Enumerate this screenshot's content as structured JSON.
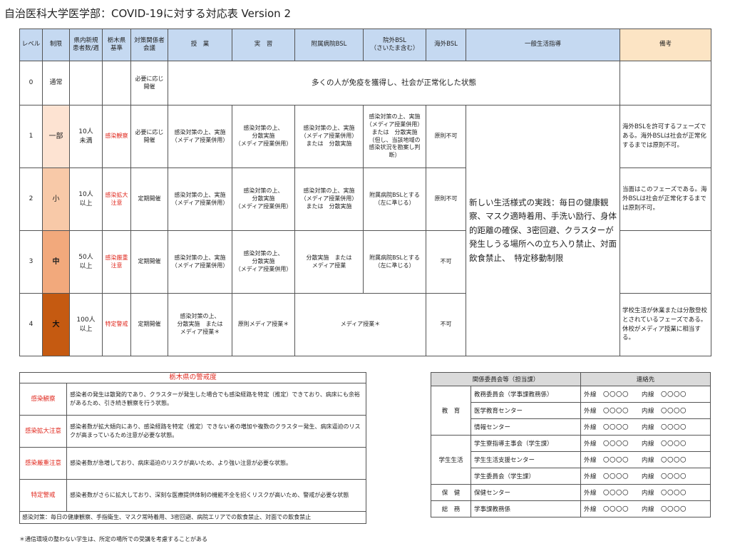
{
  "title": "自治医科大学医学部：COVID-19に対する対応表 Version 2",
  "main": {
    "headers": [
      "レベル",
      "制限",
      "県内新規\n患者数/週",
      "栃木県\n基準",
      "対策関係者\n会議",
      "授　業",
      "実　習",
      "附属病院BSL",
      "院外BSL\n（さいたま含む）",
      "海外BSL",
      "一般生活指導",
      "備考"
    ],
    "levels": [
      "0",
      "1",
      "2",
      "3",
      "4"
    ],
    "restrictions": [
      "通常",
      "一部",
      "小",
      "中",
      "大"
    ],
    "cases": [
      "",
      "10人\n未満",
      "10人\n以上",
      "50人\n以上",
      "100人\n以上"
    ],
    "tochigi": [
      "",
      "感染観察",
      "感染拡大\n注意",
      "感染厳重\n注意",
      "特定警戒"
    ],
    "meeting": [
      "必要に応じ\n開催",
      "必要に応じ\n開催",
      "定期開催",
      "定期開催",
      "定期開催"
    ],
    "level0_message": "多くの人が免疫を獲得し、社会が正常化した状態",
    "lectures": [
      "感染対策の上、実施\n（メディア授業併用）",
      "感染対策の上、実施\n（メディア授業併用）",
      "感染対策の上、実施\n（メディア授業併用）",
      "感染対策の上、\n分散実施　または\nメディア授業＊"
    ],
    "practice": [
      "感染対策の上、\n分散実施\n（メディア授業併用）",
      "感染対策の上、\n分散実施\n（メディア授業併用）",
      "感染対策の上、\n分散実施\n（メディア授業併用）",
      "原則メディア授業＊"
    ],
    "hospital_bsl": [
      "感染対策の上、実施\n（メディア授業併用）\nまたは　分散実施",
      "感染対策の上、実施\n（メディア授業併用）\nまたは　分散実施",
      "分散実施　または\nメディア授業"
    ],
    "outside_bsl": [
      "感染対策の上、実施\n（メディア授業併用）\nまたは　分散実施\n（但し、当該地域の\n感染状況を勘案し判\n断）",
      "附属病院BSLとする\n（左に準じる）",
      "附属病院BSLとする\n（左に準じる）"
    ],
    "media_only": "メディア授業＊",
    "overseas_bsl": [
      "原則不可",
      "原則不可",
      "不可",
      "不可"
    ],
    "general_life": "新しい生活様式の実践：毎日の健康観察、マスク適時着用、手洗い励行、身体的距離の確保、3密回避、クラスターが発生しうる場所への立ち入り禁止、対面飲食禁止、　特定移動制限",
    "remarks": [
      "海外BSLを許可するフェーズである。海外BSLは社会が正常化するまでは原則不可。",
      "当面はこのフェーズである。海外BSLは社会が正常化するまでは原則不可。",
      "",
      "学校生活が休業または分散登校とされているフェーズである。休校がメディア授業に相当する。"
    ]
  },
  "alert": {
    "header": "栃木県の警戒度",
    "rows": [
      {
        "name": "感染観察",
        "desc": "感染者の発生は散発的であり、クラスターが発生した場合でも感染経路を特定（推定）できており、病床にも余裕があるため、引き続き観察を行う状態。"
      },
      {
        "name": "感染拡大注意",
        "desc": "感染者数が拡大傾向にあり、感染経路を特定（推定）できない者の増加や複数のクラスター発生、病床逼迫のリスクが高まっているため注意が必要な状態。"
      },
      {
        "name": "感染厳重注意",
        "desc": "感染者数が急増しており、病床逼迫のリスクが高いため、より強い注意が必要な状態。"
      },
      {
        "name": "特定警戒",
        "desc": "感染者数がさらに拡大しており、深刻な医療提供体制の機能不全を招くリスクが高いため、警戒が必要な状態"
      }
    ],
    "note": "感染対策：毎日の健康観察、手指衛生、マスク常時着用、3密回避、病院エリアでの飲食禁止、対面での飲食禁止"
  },
  "footnote": "＊通信環境の整わない学生は、所定の場所での受講を考慮することがある",
  "contact": {
    "headers": [
      "関係委員会等（担当課）",
      "連絡先"
    ],
    "groups": [
      {
        "name": "教　育",
        "orgs": [
          "教務委員会（学事課教務係）",
          "医学教育センター",
          "情報センター"
        ]
      },
      {
        "name": "学生生活",
        "orgs": [
          "学生寮指導主事会（学生課）",
          "学生生活支援センター",
          "学生委員会（学生課）"
        ]
      },
      {
        "name": "保　健",
        "orgs": [
          "保健センター"
        ]
      },
      {
        "name": "総　務",
        "orgs": [
          "学事課教務係"
        ]
      }
    ],
    "phone": "外線　〇〇〇〇　　内線　〇〇〇〇"
  },
  "colors": {
    "header": "#c5d9f1",
    "remarks_header": "#fce4c4",
    "alert_text": "#e0281e",
    "level4": "#c55a11"
  }
}
